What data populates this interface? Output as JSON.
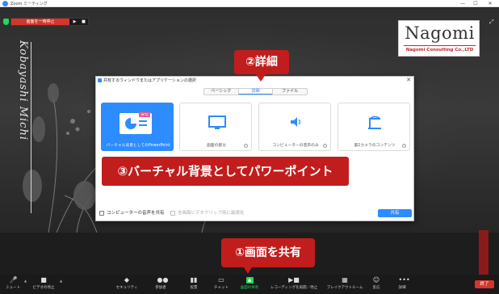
{
  "window": {
    "title": "Zoom ミーティング",
    "minimize": "—",
    "maximize": "☐",
    "close": "✕"
  },
  "share_bar": {
    "stop_label": "画面を一時停止",
    "ctl_play": "▶",
    "ctl_stop": "■"
  },
  "stage": {
    "vertical_name": "Kobayashi Michi"
  },
  "logo": {
    "wordmark": "Nagomi",
    "subtitle": "Nagomi Consulting Co.,LTD"
  },
  "callouts": {
    "detail": "②詳細",
    "virtual_bg": "③バーチャル背景としてパワーポイント",
    "share_screen": "①画面を共有"
  },
  "dialog": {
    "title": "共有するウィンドウまたはアプリケーションの選択",
    "close": "✕",
    "tabs": [
      "ベーシック",
      "詳細",
      "ファイル"
    ],
    "active_tab": "詳細",
    "cards": [
      {
        "label": "バーチャル背景としてのPowerPoint",
        "badge": "BETA",
        "selected": true,
        "icon": "slides-icon"
      },
      {
        "label": "画面の部分",
        "selected": false,
        "icon": "screen-portion-icon"
      },
      {
        "label": "コンピューターの音声のみ",
        "selected": false,
        "icon": "speaker-icon"
      },
      {
        "label": "第2カメラのコンテンツ",
        "selected": false,
        "icon": "camera-icon"
      }
    ],
    "help": "?",
    "option_audio": "コンピューターの音声を共有",
    "option_video": "全画面ビデオクリップ用に最適化",
    "share_button": "共有"
  },
  "toolbar": {
    "items": [
      {
        "label": "ミュート",
        "icon": "🎤"
      },
      {
        "label": "ビデオの停止",
        "icon": "■"
      },
      {
        "label": "セキュリティ",
        "icon": "◆"
      },
      {
        "label": "参加者",
        "icon": "●●"
      },
      {
        "label": "投票",
        "icon": "▮▮"
      },
      {
        "label": "チャット",
        "icon": "▭"
      },
      {
        "label": "画面の共有",
        "icon": "▲"
      },
      {
        "label": "レコーディングを再開／停止",
        "icon": "▶■"
      },
      {
        "label": "ブレイクアウトルーム",
        "icon": "▦"
      },
      {
        "label": "反応",
        "icon": "☺"
      },
      {
        "label": "詳細",
        "icon": "•••"
      }
    ],
    "end_label": "終了"
  },
  "colors": {
    "accent": "#2d8cff",
    "callout": "#c21d1d",
    "share_green": "#23d959",
    "end_red": "#d6352c"
  }
}
